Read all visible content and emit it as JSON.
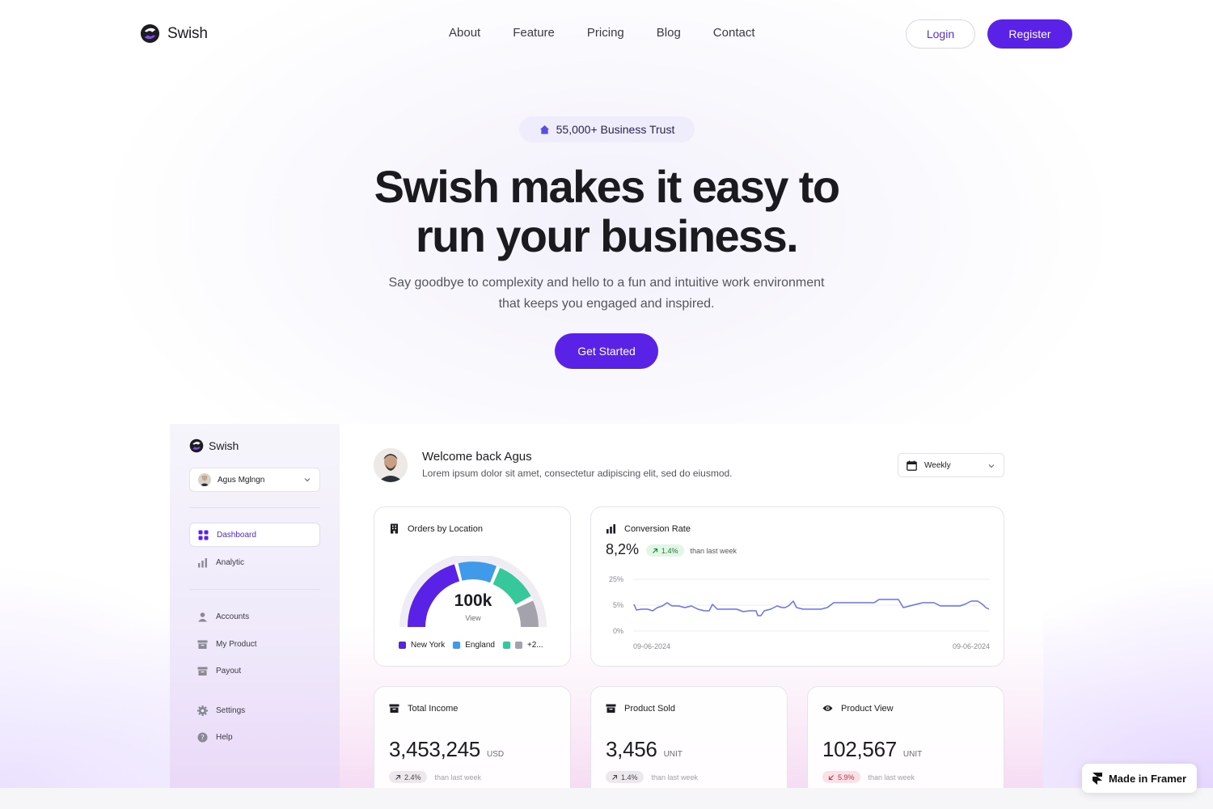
{
  "brand": {
    "name": "Swish",
    "accent": "#5a22e6"
  },
  "nav": {
    "links": [
      "About",
      "Feature",
      "Pricing",
      "Blog",
      "Contact"
    ],
    "login_label": "Login",
    "register_label": "Register"
  },
  "hero": {
    "badge": "55,000+ Business Trust",
    "title_line1": "Swish makes it easy to",
    "title_line2": "run your business.",
    "subtitle_line1": "Say goodbye to complexity and hello to a fun and intuitive work environment",
    "subtitle_line2": "that keeps you engaged and inspired.",
    "cta": "Get Started"
  },
  "dashboard": {
    "sidebar": {
      "brand": "Swish",
      "user": "Agus Mglngn",
      "items": [
        {
          "label": "Dashboard",
          "icon": "grid-icon",
          "active": true
        },
        {
          "label": "Analytic",
          "icon": "bar-chart-icon"
        },
        {
          "label": "Accounts",
          "icon": "user-icon"
        },
        {
          "label": "My Product",
          "icon": "box-icon"
        },
        {
          "label": "Payout",
          "icon": "wallet-icon"
        },
        {
          "label": "Settings",
          "icon": "gear-icon"
        },
        {
          "label": "Help",
          "icon": "help-icon"
        }
      ]
    },
    "welcome": {
      "title": "Welcome back Agus",
      "subtitle": "Lorem ipsum dolor sit amet, consectetur adipiscing elit, sed do eiusmod."
    },
    "period": "Weekly",
    "orders": {
      "title": "Orders by Location",
      "value": "100k",
      "value_label": "View",
      "legend": [
        {
          "label": "New York",
          "color": "#5a22e6"
        },
        {
          "label": "England",
          "color": "#3f9bea"
        },
        {
          "label": "",
          "color": "#36c79a"
        },
        {
          "label": "+2...",
          "color": "#a4a2ab"
        }
      ]
    },
    "conversion": {
      "title": "Conversion Rate",
      "value": "8,2%",
      "delta": "1.4%",
      "delta_note": "than last week",
      "y_ticks": [
        "25%",
        "5%",
        "0%"
      ],
      "x_start": "09-06-2024",
      "x_end": "09-06-2024"
    },
    "stats": [
      {
        "title": "Total Income",
        "icon": "wallet-icon",
        "value": "3,453,245",
        "unit": "USD",
        "delta": "2.4%",
        "direction": "up",
        "note": "than last week"
      },
      {
        "title": "Product Sold",
        "icon": "box-icon",
        "value": "3,456",
        "unit": "UNIT",
        "delta": "1.4%",
        "direction": "up",
        "note": "than last week"
      },
      {
        "title": "Product View",
        "icon": "eye-icon",
        "value": "102,567",
        "unit": "UNIT",
        "delta": "5.9%",
        "direction": "down",
        "note": "than last week"
      }
    ]
  },
  "framer_badge": "Made in Framer"
}
